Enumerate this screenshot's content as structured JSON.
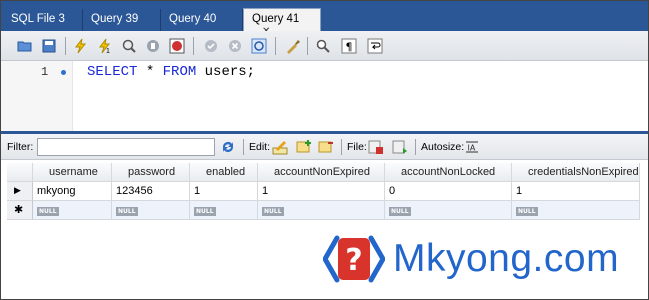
{
  "tabs": [
    {
      "label": "SQL File 3",
      "active": false
    },
    {
      "label": "Query 39",
      "active": false
    },
    {
      "label": "Query 40",
      "active": false
    },
    {
      "label": "Query 41",
      "active": true
    }
  ],
  "tab_close_glyph": "✕",
  "toolbar_icons": [
    "open-folder-icon",
    "save-icon",
    "execute-icon",
    "execute-all-icon",
    "explain-icon",
    "stop-icon",
    "stop-on-error-icon",
    "commit-icon",
    "rollback-icon",
    "autocommit-icon",
    "beautify-icon",
    "find-icon",
    "invisibles-icon",
    "wrap-icon"
  ],
  "editor": {
    "line_number": "1",
    "tokens": {
      "kw1": "SELECT",
      "mid": " * ",
      "kw2": "FROM",
      "rest": " users;"
    }
  },
  "filterbar": {
    "filter_label": "Filter:",
    "filter_value": "",
    "edit_label": "Edit:",
    "file_label": "File:",
    "autosize_label": "Autosize:"
  },
  "grid": {
    "columns": [
      "username",
      "password",
      "enabled",
      "accountNonExpired",
      "accountNonLocked",
      "credentialsNonExpired"
    ],
    "rows": [
      [
        "mkyong",
        "123456",
        "1",
        "1",
        "0",
        "1"
      ]
    ],
    "null_label": "NULL",
    "current_row_marker": "▶",
    "new_row_marker": "✱"
  },
  "logo": {
    "text": "Mkyong.com"
  },
  "colors": {
    "tab_bar": "#2b5797",
    "keyword": "#1a28d6",
    "logo_blue": "#2266cc",
    "logo_red": "#d9342b"
  }
}
